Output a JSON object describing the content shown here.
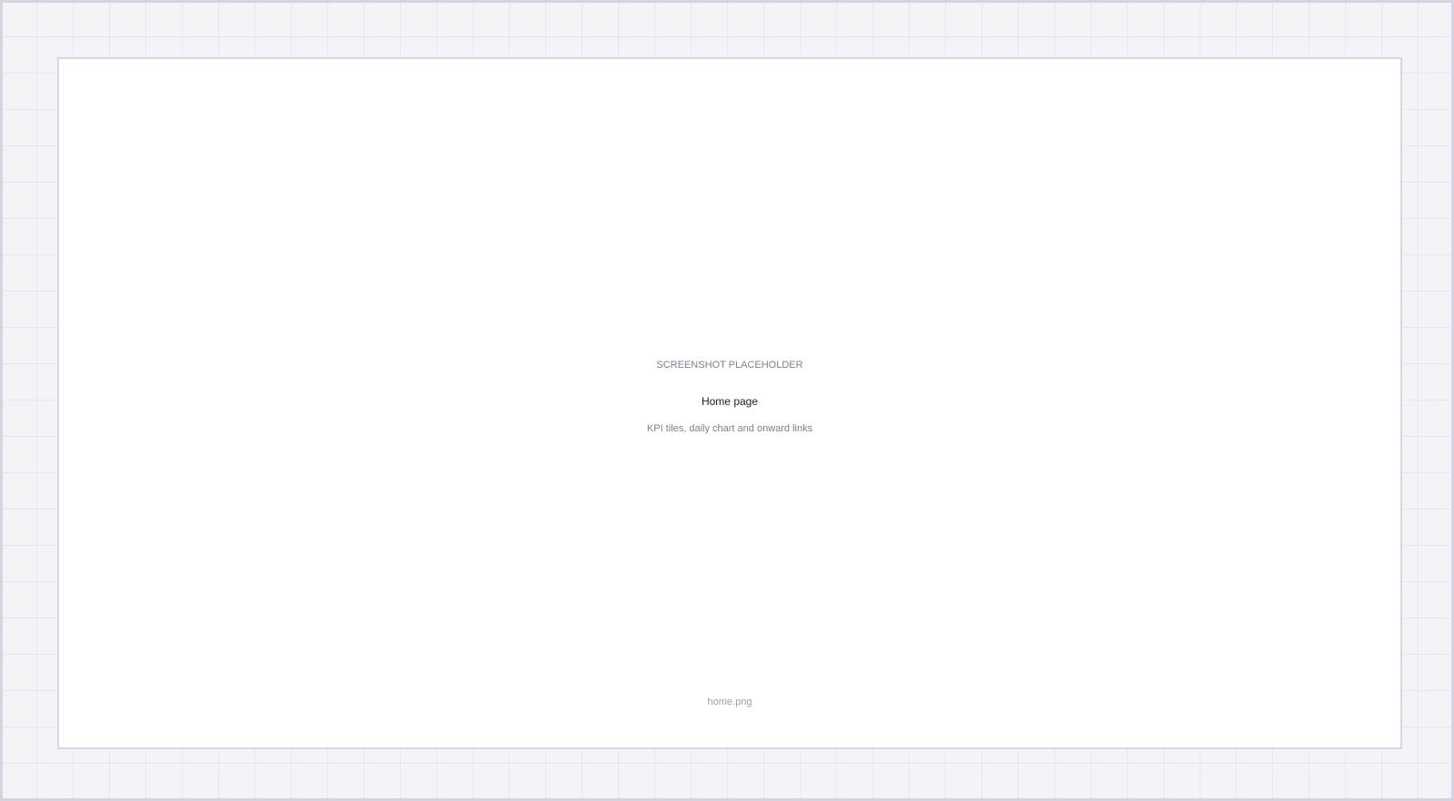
{
  "placeholder": {
    "eyebrow": "SCREENSHOT PLACEHOLDER",
    "title": "Home page",
    "description": "KPI tiles, daily chart and onward links",
    "filename": "home.png"
  },
  "colors": {
    "background": "#f3f4f7",
    "grid_line": "#e6e8ef",
    "frame_border": "#d5d8e0",
    "frame_fill": "#ffffff",
    "title_text": "#1c1f26",
    "muted_text": "#7b8191"
  }
}
